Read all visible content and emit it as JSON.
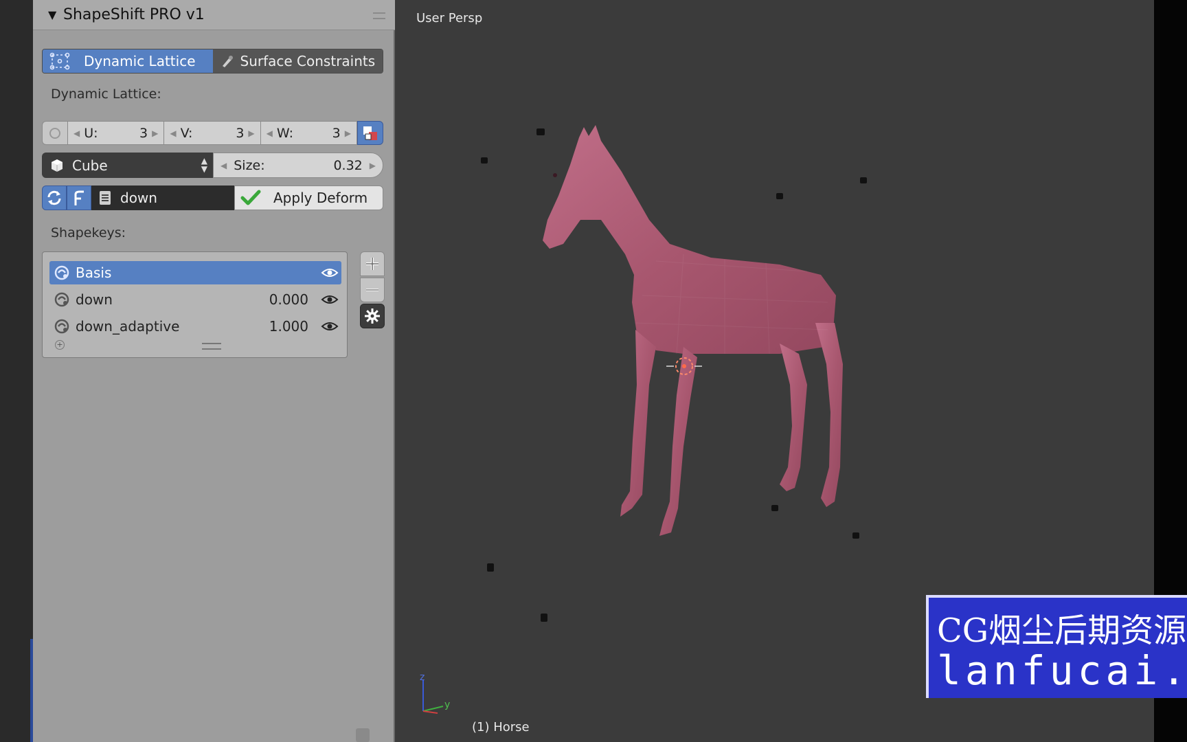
{
  "panel": {
    "title": "ShapeShift PRO v1",
    "tabs": [
      {
        "label": "Dynamic Lattice",
        "active": true
      },
      {
        "label": "Surface Constraints",
        "active": false
      }
    ],
    "lattice_section_label": "Dynamic Lattice:",
    "uvw": [
      {
        "label": "U:",
        "value": "3"
      },
      {
        "label": "V:",
        "value": "3"
      },
      {
        "label": "W:",
        "value": "3"
      }
    ],
    "shape_select": "Cube",
    "size": {
      "label": "Size:",
      "value": "0.32"
    },
    "shapekey_field": "down",
    "apply_label": "Apply Deform",
    "shapekeys_label": "Shapekeys:",
    "shapekeys": [
      {
        "name": "Basis",
        "value": "",
        "selected": true
      },
      {
        "name": "down",
        "value": "0.000",
        "selected": false
      },
      {
        "name": "down_adaptive",
        "value": "1.000",
        "selected": false
      }
    ]
  },
  "viewport": {
    "view_label": "User Persp",
    "object_label": "(1) Horse"
  },
  "watermark": {
    "line1": "CG烟尘后期资源站",
    "line2": "lanfucai.com"
  },
  "colors": {
    "accent": "#5680c2",
    "panel_bg": "#9d9d9d",
    "viewport_bg": "#3b3b3b",
    "horse": "#b5627e",
    "watermark_bg": "#2a33c8"
  }
}
